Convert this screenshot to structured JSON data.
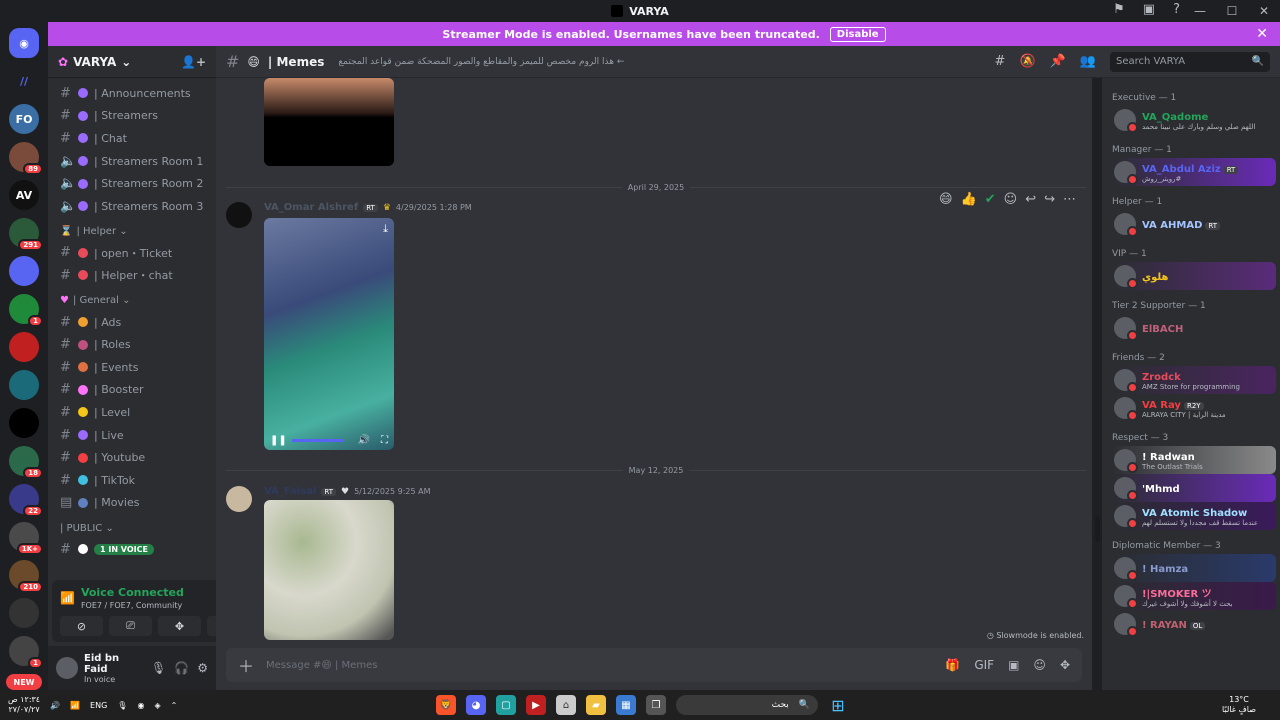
{
  "window": {
    "title": "VARYA",
    "controls": [
      "—",
      "☐",
      "✕"
    ],
    "top_icons": [
      "inbox-icon",
      "monitor-icon",
      "help-icon"
    ]
  },
  "banner": {
    "text": "Streamer Mode is enabled. Usernames have been truncated.",
    "button": "Disable"
  },
  "guilds": [
    {
      "label": "FO",
      "badge": ""
    },
    {
      "label": "",
      "badge": "89"
    },
    {
      "label": "AV",
      "badge": ""
    },
    {
      "label": "",
      "badge": "291"
    },
    {
      "label": "",
      "badge": ""
    },
    {
      "label": "",
      "badge": "1"
    },
    {
      "label": "",
      "badge": ""
    },
    {
      "label": "",
      "badge": ""
    },
    {
      "label": "",
      "badge": ""
    },
    {
      "label": "",
      "badge": "18"
    },
    {
      "label": "",
      "badge": "22"
    },
    {
      "label": "",
      "badge": "1K+"
    },
    {
      "label": "",
      "badge": "210"
    },
    {
      "label": "",
      "badge": ""
    },
    {
      "label": "",
      "badge": "1"
    }
  ],
  "guild_new_label": "NEW",
  "server": {
    "name": "VARYA"
  },
  "channels": {
    "top": [
      {
        "name": "| Announcements",
        "dot": "#9b6bff"
      },
      {
        "name": "| Streamers",
        "dot": "#9b6bff"
      },
      {
        "name": "| Chat",
        "dot": "#9b6bff"
      }
    ],
    "voice": [
      {
        "name": "| Streamers Room 1",
        "dot": "#9b6bff"
      },
      {
        "name": "| Streamers Room 2",
        "dot": "#9b6bff"
      },
      {
        "name": "| Streamers Room 3",
        "dot": "#9b6bff"
      }
    ],
    "helper_cat": "| Helper ⌄",
    "helper": [
      {
        "name": "| open・Ticket",
        "dot": "#e84b5a"
      },
      {
        "name": "| Helper・chat",
        "dot": "#e84b5a"
      }
    ],
    "general_cat": "| General ⌄",
    "general": [
      {
        "name": "| Ads",
        "dot": "#f0a030"
      },
      {
        "name": "| Roles",
        "dot": "#c05080"
      },
      {
        "name": "| Events",
        "dot": "#e07040"
      },
      {
        "name": "| Booster",
        "dot": "#ff73fa"
      },
      {
        "name": "| Level",
        "dot": "#f5c518"
      },
      {
        "name": "| Live",
        "dot": "#9b6bff"
      },
      {
        "name": "| Youtube",
        "dot": "#f23f43"
      },
      {
        "name": "| TikTok",
        "dot": "#40c0e0"
      },
      {
        "name": "| Movies",
        "dot": "#6080c0"
      }
    ],
    "public_cat": "| PUBLIC ⌄",
    "in_voice": "1 IN VOICE"
  },
  "voice_panel": {
    "title": "Voice Connected",
    "sub": "FOE7 / FOE7, Community"
  },
  "user": {
    "name": "Eid bn Faid",
    "status": "In voice"
  },
  "chat": {
    "channel_name": "| Memes",
    "topic": "هذا الروم مخصص للميمز والمقاطع والصور المضحكة ضمن قواعد المجتمع ←",
    "search_placeholder": "Search VARYA",
    "dates": [
      "April 29, 2025",
      "May 12, 2025"
    ],
    "msg1": {
      "author": "VA_Omar Alshref",
      "tag": "RT",
      "time": "4/29/2025 1:28 PM",
      "color": "#4b5563"
    },
    "msg2": {
      "author": "VA_Faisal",
      "tag": "RT",
      "time": "5/12/2025 9:25 AM",
      "color": "#2f3a60"
    },
    "slowmode": "Slowmode is enabled.",
    "composer_placeholder": "Message #😄 | Memes"
  },
  "members": [
    {
      "role": "Executive — 1",
      "role_color": "#949ba4",
      "items": [
        {
          "name": "VA_Qadome",
          "sub": "اللهم صلي وسلم وبارك على نبينا محمد",
          "color": "#23a55a",
          "bg": "",
          "tag": ""
        }
      ]
    },
    {
      "role": "Manager — 1",
      "role_color": "#949ba4",
      "items": [
        {
          "name": "VA_Abdul Aziz",
          "sub": "رويتر_روش#",
          "color": "#5865f2",
          "bg": "#6a2bb8",
          "tag": "RT"
        }
      ]
    },
    {
      "role": "Helper — 1",
      "role_color": "#949ba4",
      "items": [
        {
          "name": "VA AHMAD",
          "sub": "",
          "color": "#a3c4ff",
          "bg": "",
          "tag": "RT"
        }
      ]
    },
    {
      "role": "VIP — 1",
      "role_color": "#949ba4",
      "items": [
        {
          "name": "هلوي",
          "sub": "",
          "color": "#f5c518",
          "bg": "#5a2b7a",
          "tag": ""
        }
      ]
    },
    {
      "role": "Tier 2 Supporter — 1",
      "role_color": "#949ba4",
      "items": [
        {
          "name": "ElBACH",
          "sub": "",
          "color": "#c0607a",
          "bg": "",
          "tag": ""
        }
      ]
    },
    {
      "role": "Friends — 2",
      "role_color": "#949ba4",
      "items": [
        {
          "name": "Zrodck",
          "sub": "AMZ Store for programming",
          "color": "#e84b5a",
          "bg": "#4a2560",
          "tag": ""
        },
        {
          "name": "VA Ray",
          "sub": "ALRAYA CITY | مدينة الراية",
          "color": "#f23f43",
          "bg": "",
          "tag": "R2Y"
        }
      ]
    },
    {
      "role": "Respect — 3",
      "role_color": "#949ba4",
      "items": [
        {
          "name": "! Radwan",
          "sub": "The Outlast Trials",
          "color": "#ffffff",
          "bg": "#8a8a8a",
          "tag": ""
        },
        {
          "name": "'Mhmd",
          "sub": "",
          "color": "#ffffff",
          "bg": "#6a2bb8",
          "tag": ""
        },
        {
          "name": "VA Atomic Shadow",
          "sub": "عندما تسقط قف مجددا ولا تستسلم لهم",
          "color": "#a0e0ff",
          "bg": "#3a1a5a",
          "tag": ""
        }
      ]
    },
    {
      "role": "Diplomatic Member — 3",
      "role_color": "#949ba4",
      "items": [
        {
          "name": "! Hamza",
          "sub": "",
          "color": "#8a9bd0",
          "bg": "#2a3a6a",
          "tag": ""
        },
        {
          "name": "!|SMOKER ツ",
          "sub": "بحث لا أشوفك ولا أشوف غيرك",
          "color": "#ff6b9a",
          "bg": "#3a1a4a",
          "tag": ""
        },
        {
          "name": "! RAYAN",
          "sub": "",
          "color": "#c06070",
          "bg": "",
          "tag": "OL"
        }
      ]
    }
  ],
  "taskbar": {
    "time": "١٢:٣٤ ص",
    "date": "٢٧/٠٧/٢٧",
    "lang": "ENG",
    "search": "بحث",
    "weather_temp": "13°C",
    "weather_text": "صافٍ غالبًا"
  }
}
